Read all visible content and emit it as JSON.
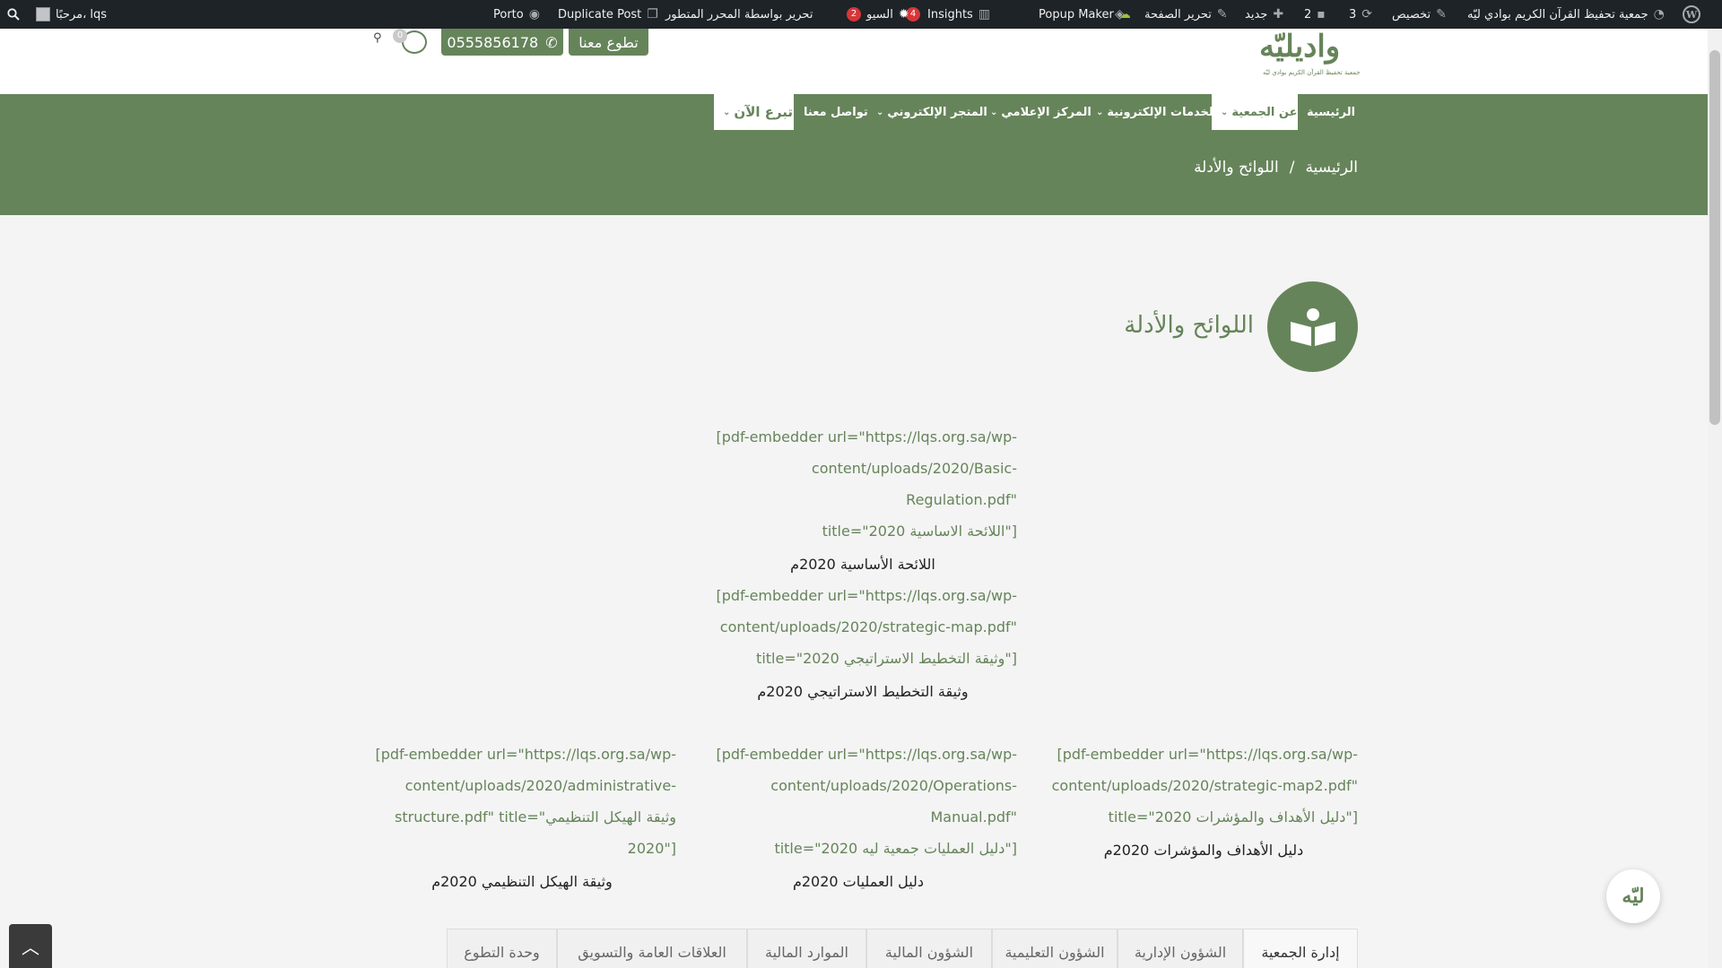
{
  "adminbar": {
    "site_name": "جمعية تحفيظ القرآن الكريم بوادي ليّه",
    "customize": "تخصيص",
    "updates_count": "3",
    "comments_count": "2",
    "new": "جديد",
    "edit_page": "تحرير الصفحة",
    "popup_maker": "Popup Maker",
    "insights": "Insights",
    "insights_badge": "4",
    "seo": "السيو",
    "seo_badge": "2",
    "advanced_editor": "تحرير بواسطة المحرر المتطور",
    "duplicate_post": "Duplicate Post",
    "porto": "Porto",
    "greeting": "مرحبًا، lqs"
  },
  "header": {
    "logo_text": "واديليّه",
    "logo_subtitle": "جمعية تحفيظ القرآن الكريم بوادي ليّه",
    "volunteer_button": "تطوع معنا",
    "phone": "0555856178",
    "cart_count": "0"
  },
  "nav": {
    "items": [
      {
        "label": "الرئيسية"
      },
      {
        "label": "عن الجمعية"
      },
      {
        "label": "الخدمات الإلكترونية"
      },
      {
        "label": "المركز الإعلامي"
      },
      {
        "label": "المتجر الإلكتروني"
      },
      {
        "label": "تواصل معنا"
      },
      {
        "label": "تبرع الآن"
      }
    ],
    "active_index": 1
  },
  "breadcrumb": {
    "home": "الرئيسية",
    "separator": "/",
    "current": "اللوائح والأدلة"
  },
  "page": {
    "title": "اللوائح والأدلة"
  },
  "documents": [
    {
      "code_lines": [
        "[pdf-embedder url=\"https://lqs.org.sa/wp-",
        "content/uploads/2020/Basic-Regulation.pdf\"",
        "title=\"اللائحة الاساسية 2020\"]"
      ],
      "caption": "اللائحة الأساسية 2020م"
    },
    {
      "code_lines": [
        "[pdf-embedder url=\"https://lqs.org.sa/wp-",
        "content/uploads/2020/strategic-map.pdf\"",
        "title=\"وثيقة التخطيط الاستراتيجي 2020\"]"
      ],
      "caption": "وثيقة التخطيط الاستراتيجي 2020م"
    },
    {
      "code_lines": [
        "[pdf-embedder url=\"https://lqs.org.sa/wp-",
        "content/uploads/2020/strategic-map2.pdf\"",
        "title=\"دليل الأهداف والمؤشرات 2020\"]"
      ],
      "caption": "دليل الأهداف والمؤشرات 2020م"
    },
    {
      "code_lines": [
        "[pdf-embedder url=\"https://lqs.org.sa/wp-",
        "content/uploads/2020/Operations-Manual.pdf\"",
        "title=\"دليل العمليات جمعية ليه 2020\"]"
      ],
      "caption": "دليل العمليات 2020م"
    },
    {
      "code_lines": [
        "[pdf-embedder url=\"https://lqs.org.sa/wp-",
        "content/uploads/2020/administrative-",
        "structure.pdf\" title=\"وثيقة الهيكل التنظيمي",
        "2020\"]"
      ],
      "caption": "وثيقة الهيكل التنظيمي 2020م"
    }
  ],
  "tabs": [
    {
      "label": "إدارة الجمعية"
    },
    {
      "label": "الشؤون الإدارية"
    },
    {
      "label": "الشؤون التعليمية"
    },
    {
      "label": "الشؤون المالية"
    },
    {
      "label": "الموارد المالية"
    },
    {
      "label": "العلاقات العامة والتسويق"
    },
    {
      "label": "وحدة التطوع"
    }
  ],
  "colors": {
    "brand_green": "#66845a",
    "adminbar_bg": "#1d2327",
    "badge_red": "#d63638"
  }
}
